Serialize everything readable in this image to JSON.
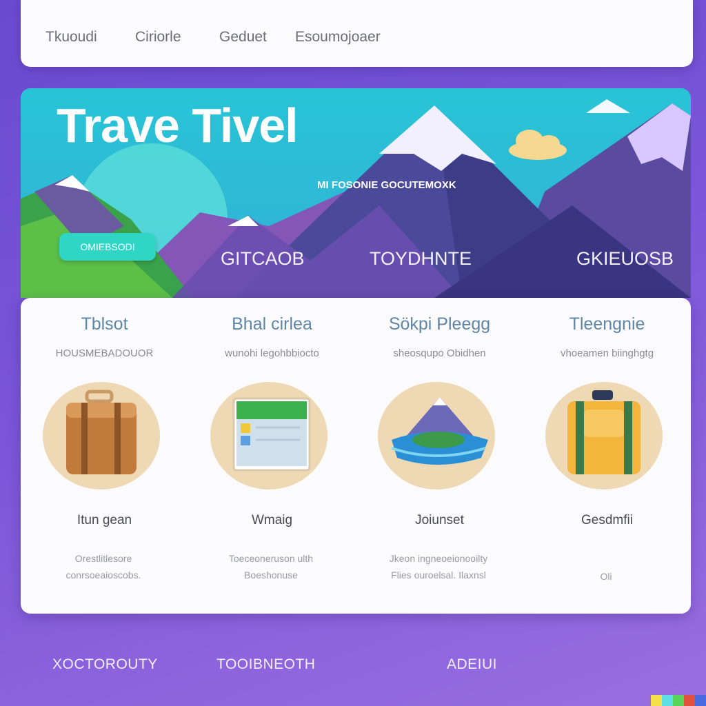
{
  "nav": {
    "items": [
      "Tkuoudi",
      "Ciriorle",
      "Geduet",
      "Esoumojoaer"
    ]
  },
  "hero": {
    "title": "Trave Tivel",
    "subtitle": "MI FOSONIE GOCUTEMOXK",
    "cta_label": "OMIEBSODI",
    "links": [
      "GITCAOB",
      "TOYDHNTE",
      "GKIEUOSB"
    ]
  },
  "features": [
    {
      "title": "Tblsot",
      "tagline": "HOUSMEBADOUOR",
      "icon": "suitcase-icon",
      "name": "Itun gean",
      "description": [
        "Orestlitlesore",
        "conrsoeaioscobs."
      ]
    },
    {
      "title": "Bhal cirlea",
      "tagline": "wunohi legohbbiocto",
      "icon": "map-photo-icon",
      "name": "Wmaig",
      "description": [
        "Toeceoneruson ulth",
        "Boeshonuse"
      ]
    },
    {
      "title": "Sökpi Pleegg",
      "tagline": "sheosqupo Obidhen",
      "icon": "island-landscape-icon",
      "name": "Joiunset",
      "description": [
        "Jkeon ingneoeionooilty",
        "Flies ouroelsal. Ilaxnsl"
      ]
    },
    {
      "title": "Tleengnie",
      "tagline": "vhoeamen biinghgtg",
      "icon": "backpack-icon",
      "name": "Gesdmfii",
      "description": [
        "Oli"
      ]
    }
  ],
  "footer": {
    "links": [
      "XOCTOROUTY",
      "TOOIBNEOTH",
      "ADEIUI"
    ]
  },
  "colors": {
    "accent": "#2fd6c6",
    "hero_sky": "#28c4d6",
    "background": "#7a55d8"
  }
}
